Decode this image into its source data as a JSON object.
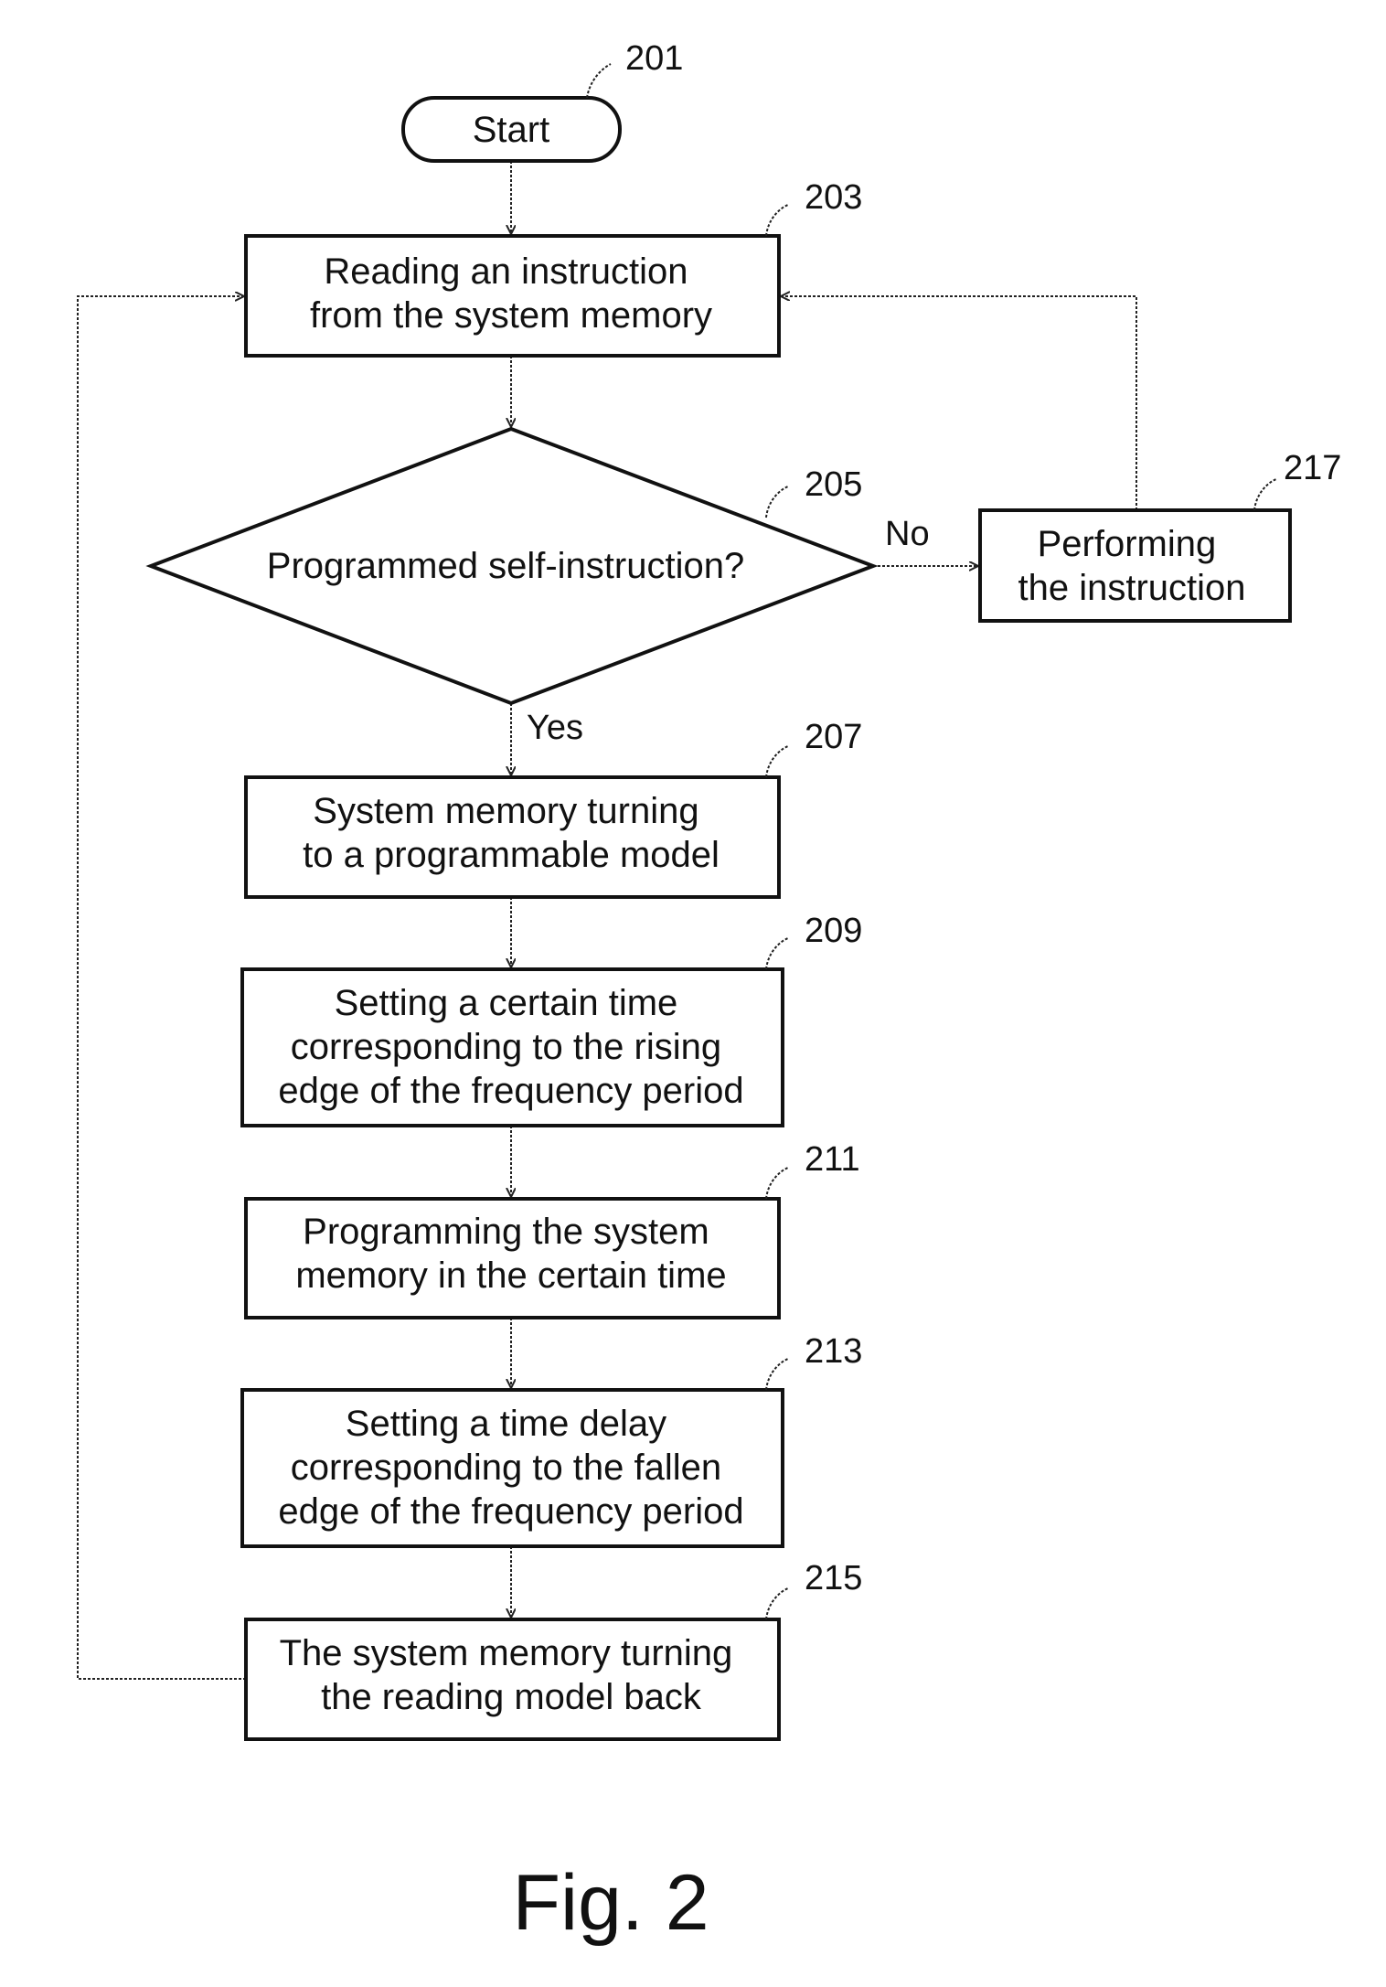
{
  "figure": {
    "caption": "Fig. 2",
    "type": "flowchart"
  },
  "nodes": {
    "start": {
      "ref": "201",
      "lines": [
        "Start"
      ],
      "shape": "terminator"
    },
    "read": {
      "ref": "203",
      "lines": [
        "Reading an instruction",
        "from the system memory"
      ],
      "shape": "process"
    },
    "decision": {
      "ref": "205",
      "lines": [
        "Programmed self-instruction?"
      ],
      "shape": "decision"
    },
    "perform": {
      "ref": "217",
      "lines": [
        "Performing",
        "the instruction"
      ],
      "shape": "process"
    },
    "turn_prog": {
      "ref": "207",
      "lines": [
        "System memory turning",
        "to a programmable model"
      ],
      "shape": "process"
    },
    "set_time": {
      "ref": "209",
      "lines": [
        "Setting a certain time",
        "corresponding to the rising",
        "edge of the frequency period"
      ],
      "shape": "process"
    },
    "program": {
      "ref": "211",
      "lines": [
        "Programming the system",
        "memory in the certain time"
      ],
      "shape": "process"
    },
    "set_delay": {
      "ref": "213",
      "lines": [
        "Setting a time delay",
        "corresponding to the fallen",
        "edge of the frequency period"
      ],
      "shape": "process"
    },
    "turn_back": {
      "ref": "215",
      "lines": [
        "The system memory turning",
        "the reading model back"
      ],
      "shape": "process"
    }
  },
  "edges": [
    {
      "from": "start",
      "to": "read",
      "label": ""
    },
    {
      "from": "read",
      "to": "decision",
      "label": ""
    },
    {
      "from": "decision",
      "to": "perform",
      "label": "No"
    },
    {
      "from": "decision",
      "to": "turn_prog",
      "label": "Yes"
    },
    {
      "from": "perform",
      "to": "read",
      "label": ""
    },
    {
      "from": "turn_prog",
      "to": "set_time",
      "label": ""
    },
    {
      "from": "set_time",
      "to": "program",
      "label": ""
    },
    {
      "from": "program",
      "to": "set_delay",
      "label": ""
    },
    {
      "from": "set_delay",
      "to": "turn_back",
      "label": ""
    },
    {
      "from": "turn_back",
      "to": "read",
      "label": ""
    }
  ]
}
